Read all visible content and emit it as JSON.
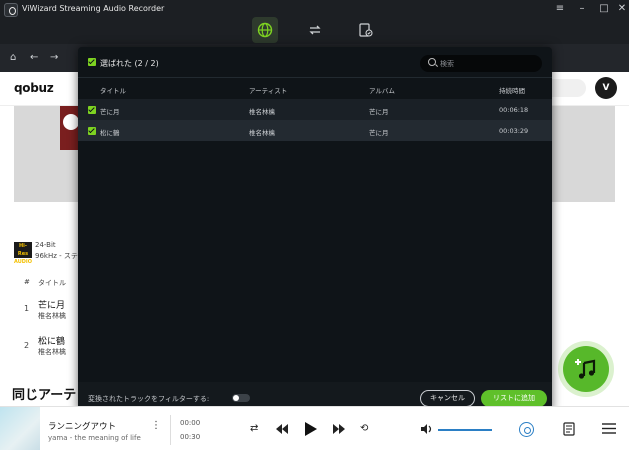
{
  "window": {
    "title": "ViWizard Streaming Audio Recorder",
    "controls": [
      "≡",
      "–",
      "□",
      "✕"
    ]
  },
  "mode_tabs": [
    "globe-icon",
    "convert-icon",
    "history-icon"
  ],
  "browser": {
    "logo": "qobuz",
    "avatar_letter": "V",
    "quality_line1": "24-Bit",
    "quality_line2": "96kHz - ステ",
    "hires_badge": "Hi-Res AUDIO",
    "title_column": "タイトル",
    "tracks": [
      {
        "num": "1",
        "title": "芒に月",
        "artist": "椎名林檎"
      },
      {
        "num": "2",
        "title": "松に鶴",
        "artist": "椎名林檎"
      }
    ],
    "section_heading": "同じアーテ"
  },
  "modal": {
    "select_label": "選ばれた (2 / 2)",
    "search_placeholder": "検索",
    "columns": {
      "title": "タイトル",
      "artist": "アーティスト",
      "album": "アルバム",
      "duration": "持続時間"
    },
    "rows": [
      {
        "title": "芒に月",
        "artist": "椎名林檎",
        "album": "芒に月",
        "duration": "00:06:18"
      },
      {
        "title": "松に鶴",
        "artist": "椎名林檎",
        "album": "芒に月",
        "duration": "00:03:29"
      }
    ],
    "filter_label": "変換されたトラックをフィルターする:",
    "cancel_label": "キャンセル",
    "add_label": "リストに追加"
  },
  "player": {
    "title": "ランニングアウト",
    "artist": "yama - the meaning of life",
    "elapsed": "00:00",
    "total": "00:30"
  },
  "colors": {
    "accent_green": "#5fc02a",
    "modal_bg": "#0f1418",
    "player_blue": "#2b7fc5"
  }
}
